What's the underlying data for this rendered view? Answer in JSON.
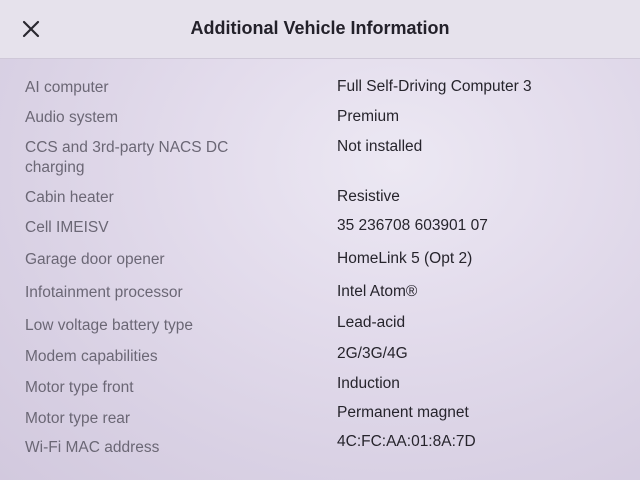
{
  "header": {
    "title": "Additional Vehicle Information",
    "close_icon": "close-icon"
  },
  "rows": [
    {
      "label": "AI computer",
      "value": "Full Self-Driving Computer 3"
    },
    {
      "label": "Audio system",
      "value": "Premium"
    },
    {
      "label": "CCS and 3rd-party NACS DC charging",
      "value": "Not installed"
    },
    {
      "label": "Cabin heater",
      "value": "Resistive"
    },
    {
      "label": "Cell IMEISV",
      "value": "35 236708 603901 07"
    },
    {
      "label": "Garage door opener",
      "value": "HomeLink 5 (Opt 2)"
    },
    {
      "label": "Infotainment processor",
      "value": "Intel Atom®"
    },
    {
      "label": "Low voltage battery type",
      "value": "Lead-acid"
    },
    {
      "label": "Modem capabilities",
      "value": "2G/3G/4G"
    },
    {
      "label": "Motor type front",
      "value": "Induction"
    },
    {
      "label": "Motor type rear",
      "value": "Permanent magnet"
    },
    {
      "label": "Wi-Fi MAC address",
      "value": "4C:FC:AA:01:8A:7D"
    }
  ]
}
